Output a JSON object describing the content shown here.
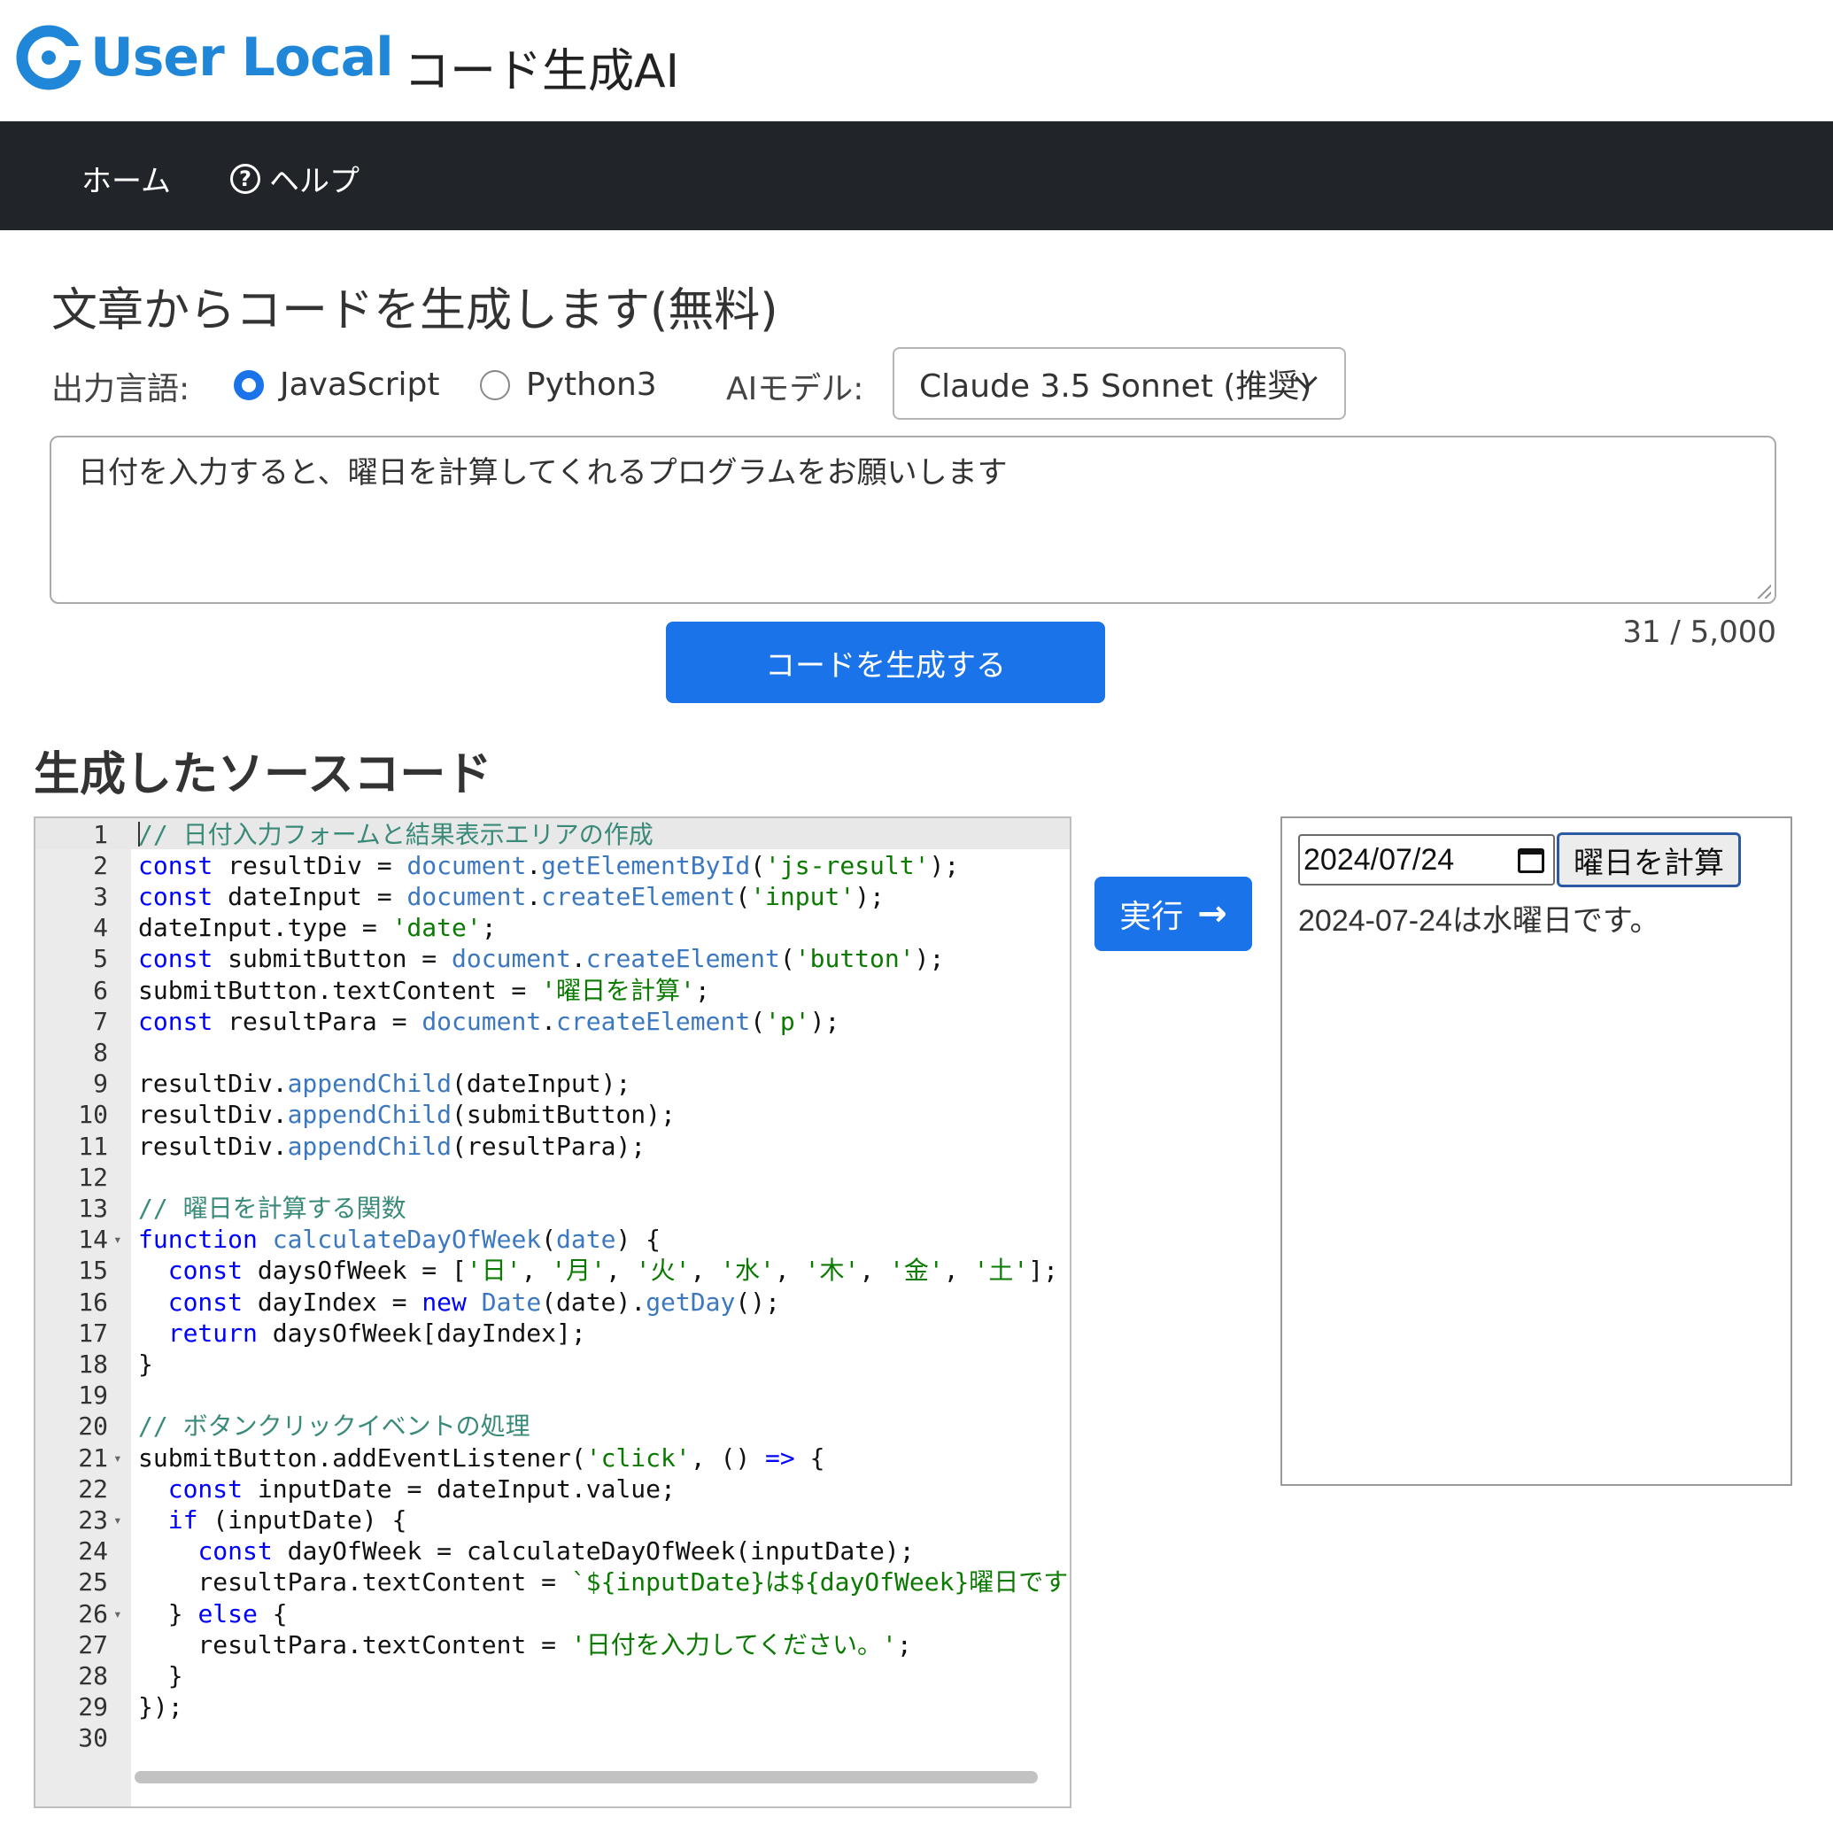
{
  "header": {
    "logo_text": "User Local",
    "app_name": "コード生成AI"
  },
  "nav": {
    "home": "ホーム",
    "help_icon": "?",
    "help": "ヘルプ"
  },
  "form": {
    "title": "文章からコードを生成します(無料)",
    "output_lang_label": "出力言語:",
    "lang_options": [
      "JavaScript",
      "Python3"
    ],
    "selected_lang": "JavaScript",
    "ai_model_label": "AIモデル:",
    "ai_model_value": "Claude 3.5 Sonnet (推奨)",
    "prompt_text": "日付を入力すると、曜日を計算してくれるプログラムをお願いします",
    "char_count": "31 / 5,000",
    "generate_button": "コードを生成する"
  },
  "output": {
    "section_title": "生成したソースコード",
    "run_button": "実行",
    "run_icon": "arrow-right-icon"
  },
  "code_lines": [
    "// 日付入力フォームと結果表示エリアの作成",
    "const resultDiv = document.getElementById('js-result');",
    "const dateInput = document.createElement('input');",
    "dateInput.type = 'date';",
    "const submitButton = document.createElement('button');",
    "submitButton.textContent = '曜日を計算';",
    "const resultPara = document.createElement('p');",
    "",
    "resultDiv.appendChild(dateInput);",
    "resultDiv.appendChild(submitButton);",
    "resultDiv.appendChild(resultPara);",
    "",
    "// 曜日を計算する関数",
    "function calculateDayOfWeek(date) {",
    "  const daysOfWeek = ['日', '月', '火', '水', '木', '金', '土'];",
    "  const dayIndex = new Date(date).getDay();",
    "  return daysOfWeek[dayIndex];",
    "}",
    "",
    "// ボタンクリックイベントの処理",
    "submitButton.addEventListener('click', () => {",
    "  const inputDate = dateInput.value;",
    "  if (inputDate) {",
    "    const dayOfWeek = calculateDayOfWeek(inputDate);",
    "    resultPara.textContent = `${inputDate}は${dayOfWeek}曜日です",
    "  } else {",
    "    resultPara.textContent = '日付を入力してください。';",
    "  }",
    "});",
    ""
  ],
  "fold_lines": [
    14,
    21,
    23,
    26
  ],
  "result": {
    "date_value": "2024/07/24",
    "calc_button": "曜日を計算",
    "result_text": "2024-07-24は水曜日です。"
  },
  "colors": {
    "brand": "#1f86d8",
    "primary_button": "#1a73e8",
    "navbar": "#212529"
  }
}
